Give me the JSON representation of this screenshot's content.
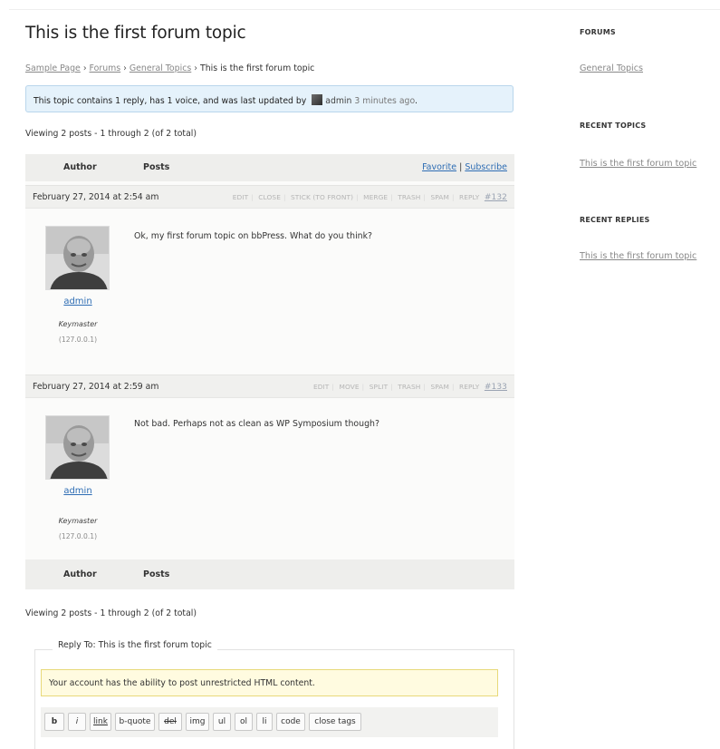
{
  "topic": {
    "title": "This is the first forum topic",
    "breadcrumb": [
      "Sample Page",
      "Forums",
      "General Topics",
      "This is the first forum topic"
    ],
    "breadcrumb_separator": "›",
    "notice": {
      "prefix": "This topic contains 1 reply, has 1 voice, and was last updated by",
      "user": "admin",
      "ago": "3 minutes ago",
      "suffix": "."
    },
    "viewing_count": "Viewing 2 posts - 1 through 2 (of 2 total)"
  },
  "table": {
    "author_header": "Author",
    "posts_header": "Posts",
    "favorite_label": "Favorite",
    "separator": "|",
    "subscribe_label": "Subscribe"
  },
  "posts": [
    {
      "date": "February 27, 2014 at 2:54 am",
      "actions": [
        "EDIT",
        "CLOSE",
        "STICK (TO FRONT)",
        "MERGE",
        "TRASH",
        "SPAM",
        "REPLY"
      ],
      "permalink": "#132",
      "author": "admin",
      "role": "Keymaster",
      "ip": "(127.0.0.1)",
      "content": "Ok, my first forum topic on bbPress. What do you think?"
    },
    {
      "date": "February 27, 2014 at 2:59 am",
      "actions": [
        "EDIT",
        "MOVE",
        "SPLIT",
        "TRASH",
        "SPAM",
        "REPLY"
      ],
      "permalink": "#133",
      "author": "admin",
      "role": "Keymaster",
      "ip": "(127.0.0.1)",
      "content": "Not bad. Perhaps not as clean as WP Symposium though?"
    }
  ],
  "reply": {
    "legend": "Reply To: This is the first forum topic",
    "notice": "Your account has the ability to post unrestricted HTML content.",
    "toolbar": [
      "b",
      "i",
      "link",
      "b-quote",
      "del",
      "img",
      "ul",
      "ol",
      "li",
      "code",
      "close tags"
    ]
  },
  "sidebar": {
    "forums_title": "FORUMS",
    "forums_link": "General Topics",
    "recent_topics_title": "RECENT TOPICS",
    "recent_topics_link": "This is the first forum topic",
    "recent_replies_title": "RECENT REPLIES",
    "recent_replies_link": "This is the first forum topic"
  },
  "colors": {
    "link": "#2e6db4",
    "info_notice_bg": "#e5f2fb",
    "warn_notice_bg": "#fffbe0"
  }
}
